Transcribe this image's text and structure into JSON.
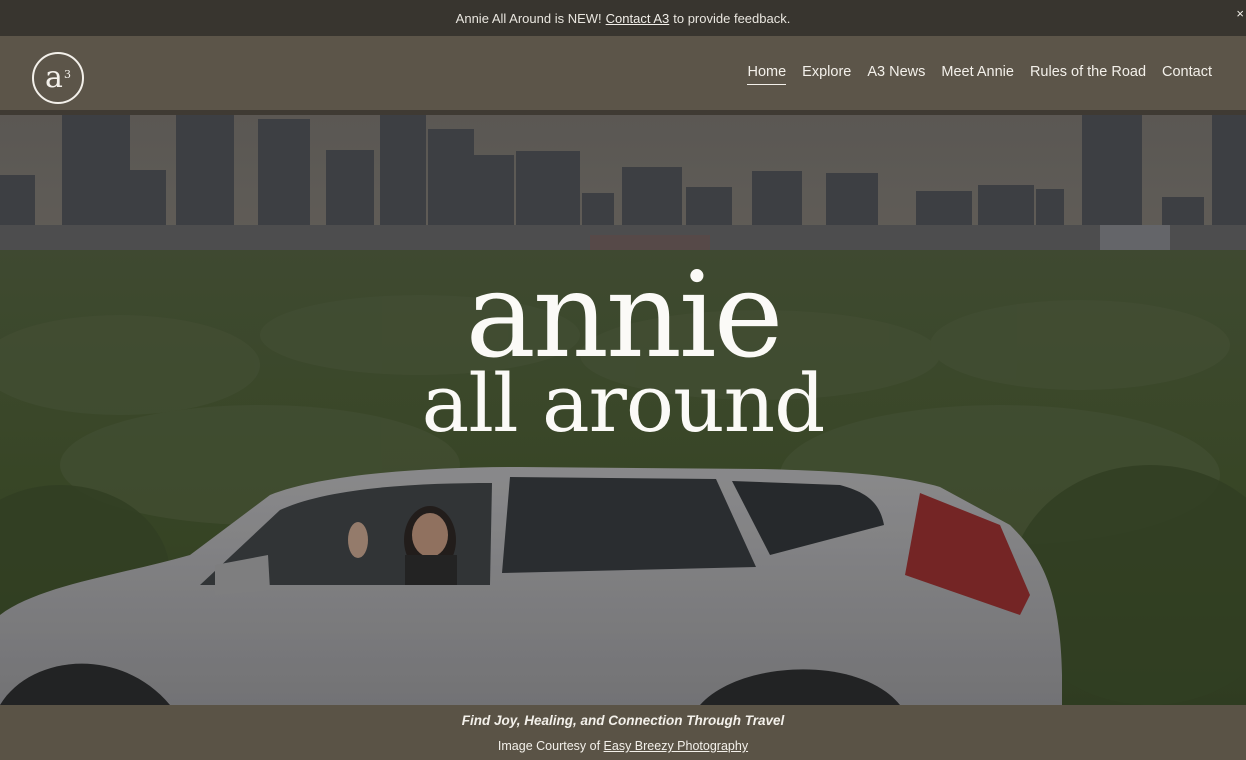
{
  "announcement": {
    "prefix": "Annie All Around is NEW!",
    "link": "Contact A3",
    "suffix": "to provide feedback.",
    "close": "×"
  },
  "logo": {
    "letter": "a",
    "superscript": "3"
  },
  "nav": {
    "items": [
      {
        "label": "Home",
        "active": true
      },
      {
        "label": "Explore"
      },
      {
        "label": "A3 News"
      },
      {
        "label": "Meet Annie"
      },
      {
        "label": "Rules of the Road"
      },
      {
        "label": "Contact"
      }
    ]
  },
  "hero": {
    "title_line1": "annie",
    "title_line2": "all around"
  },
  "caption": {
    "tagline": "Find Joy, Healing, and Connection Through Travel",
    "credit_prefix": "Image Courtesy of",
    "credit_link": "Easy Breezy Photography"
  },
  "colors": {
    "announcement_bg": "#38352f",
    "header_bg": "#5c5549",
    "text_light": "#f3f0ea"
  }
}
